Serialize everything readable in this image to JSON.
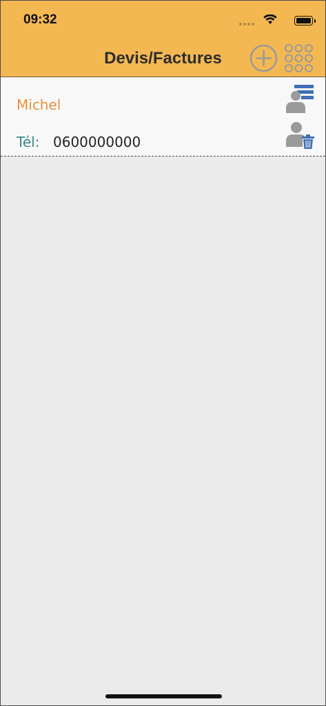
{
  "status_bar": {
    "time": "09:32"
  },
  "nav": {
    "title": "Devis/Factures"
  },
  "clients": [
    {
      "name": "Michel",
      "phone_label": "Tél:",
      "phone": "0600000000"
    }
  ],
  "colors": {
    "header_bg": "#f4b852",
    "name_color": "#e8913a",
    "label_color": "#3a8a8a",
    "icon_blue": "#3f6fb5",
    "icon_gray": "#9a9a9a"
  },
  "icons": {
    "add": "plus-circle-icon",
    "menu": "grid-dots-icon",
    "client_list": "user-list-icon",
    "client_delete": "user-delete-icon"
  }
}
